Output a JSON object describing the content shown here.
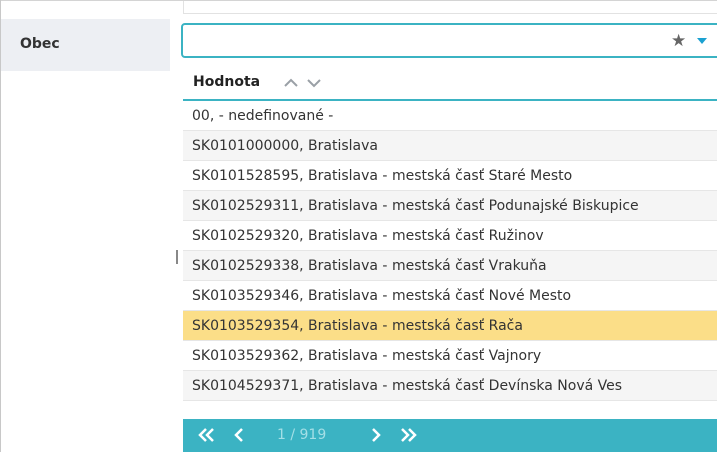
{
  "field": {
    "label": "Obec",
    "value": "",
    "placeholder": ""
  },
  "icons": {
    "favorite": "star-icon",
    "dropdown": "caret-down-icon",
    "accent_color": "#3bb3c3",
    "selected_row_color": "#fbde88"
  },
  "dropdown": {
    "column_header": "Hodnota",
    "rows": [
      {
        "text": "00, - nedefinované -"
      },
      {
        "text": "SK0101000000, Bratislava"
      },
      {
        "text": "SK0101528595, Bratislava - mestská časť Staré Mesto"
      },
      {
        "text": "SK0102529311, Bratislava - mestská časť Podunajské Biskupice"
      },
      {
        "text": "SK0102529320, Bratislava - mestská časť Ružinov"
      },
      {
        "text": "SK0102529338, Bratislava - mestská časť Vrakuňa"
      },
      {
        "text": "SK0103529346, Bratislava - mestská časť Nové Mesto"
      },
      {
        "text": "SK0103529354, Bratislava - mestská časť Rača",
        "selected": true
      },
      {
        "text": "SK0103529362, Bratislava - mestská časť Vajnory"
      },
      {
        "text": "SK0104529371, Bratislava - mestská časť Devínska Nová Ves"
      }
    ]
  },
  "pagination": {
    "info": "1 / 919"
  }
}
